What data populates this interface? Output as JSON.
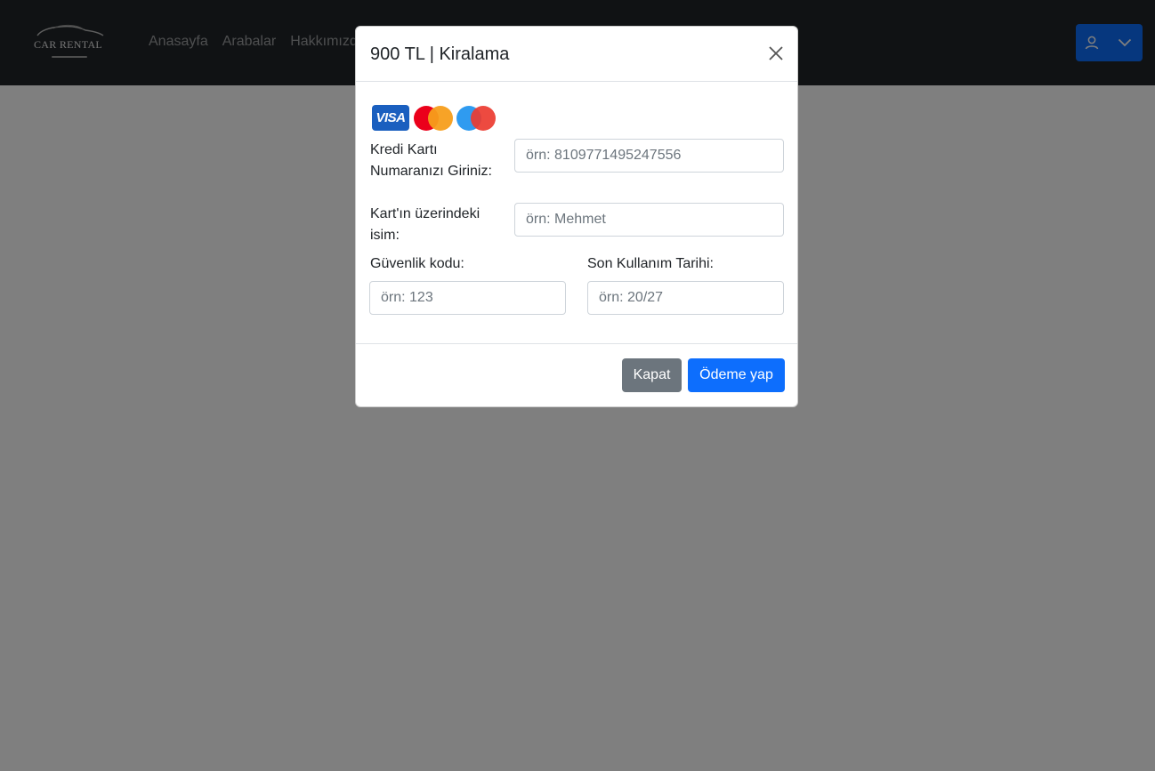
{
  "navbar": {
    "logo_text": "CAR RENTAL",
    "links": [
      "Anasayfa",
      "Arabalar",
      "Hakkımızda"
    ],
    "user_icon": "user-icon",
    "dropdown_icon": "chevron-down-icon",
    "accent_color": "#0d6efd",
    "background_color": "#212529"
  },
  "modal": {
    "title": "900 TL | Kiralama",
    "close_icon": "close-icon",
    "card_brands": [
      "VISA",
      "Mastercard",
      "Maestro"
    ],
    "fields": {
      "card_number": {
        "label": "Kredi Kartı Numaranızı Giriniz:",
        "placeholder": "örn: 8109771495247556",
        "value": ""
      },
      "card_name": {
        "label": "Kart'ın üzerindeki isim:",
        "placeholder": "örn: Mehmet",
        "value": ""
      },
      "cvv": {
        "label": "Güvenlik kodu:",
        "placeholder": "örn: 123",
        "value": ""
      },
      "expiry": {
        "label": "Son Kullanım Tarihi:",
        "placeholder": "örn: 20/27",
        "value": ""
      }
    },
    "buttons": {
      "close_label": "Kapat",
      "pay_label": "Ödeme yap"
    }
  }
}
